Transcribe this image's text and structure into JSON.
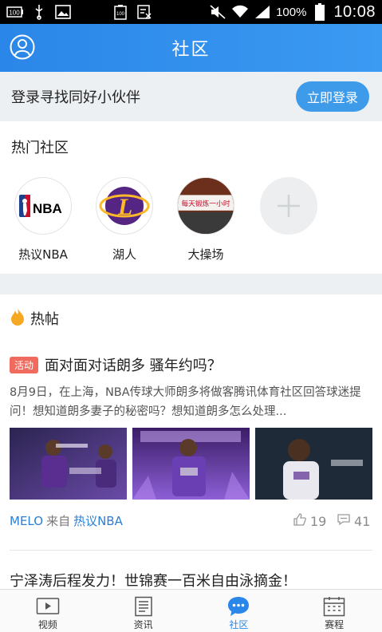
{
  "status_bar": {
    "battery_small": "100",
    "battery_pct": "100%",
    "time": "10:08"
  },
  "header": {
    "title": "社区"
  },
  "login": {
    "prompt": "登录寻找同好小伙伴",
    "button": "立即登录"
  },
  "hot_communities": {
    "title": "热门社区",
    "items": [
      {
        "label": "热议NBA",
        "logo_text": "NBA"
      },
      {
        "label": "湖人",
        "logo_text": "L"
      },
      {
        "label": "大操场",
        "logo_text": "每天锻炼一小时"
      },
      {
        "label": ""
      }
    ]
  },
  "hot_posts": {
    "title": "热帖",
    "posts": [
      {
        "tag": "活动",
        "title": "面对面对话朗多 骚年约吗？",
        "excerpt": "8月9日，在上海，NBA传球大师朗多将做客腾讯体育社区回答球迷提问！想知道朗多妻子的秘密吗？想知道朗多怎么处理...",
        "author": "MELO",
        "from": "来自",
        "source": "热议NBA",
        "likes": "19",
        "comments": "41"
      },
      {
        "title": "宁泽涛后程发力！世锦赛一百米自由泳摘金！"
      }
    ]
  },
  "bottom_nav": {
    "items": [
      {
        "label": "视频",
        "icon": "video-icon"
      },
      {
        "label": "资讯",
        "icon": "news-icon"
      },
      {
        "label": "社区",
        "icon": "community-icon"
      },
      {
        "label": "赛程",
        "icon": "calendar-icon"
      }
    ]
  },
  "colors": {
    "accent": "#2a86e8",
    "login_button": "#3d9be9",
    "tag": "#f06a5e",
    "link": "#2a7fd6",
    "band": "#ecf0f3"
  }
}
